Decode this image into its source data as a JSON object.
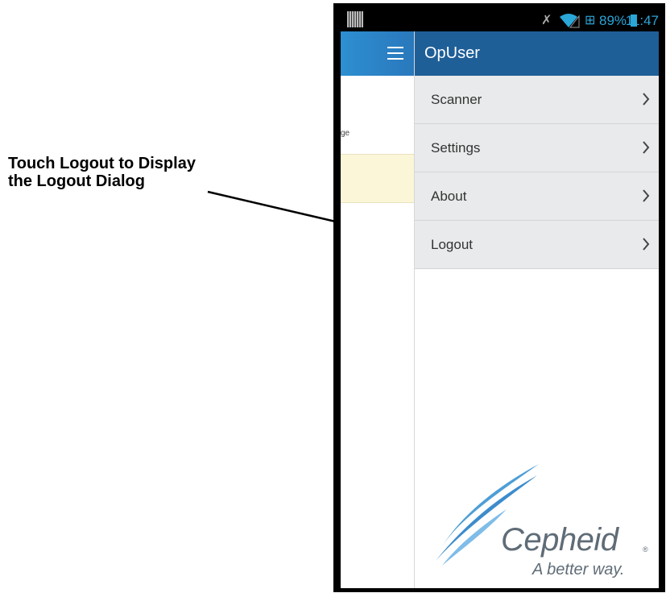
{
  "callout": {
    "line1": "Touch Logout to Display",
    "line2": "the Logout Dialog"
  },
  "status_bar": {
    "battery": "89%",
    "time": "11:47"
  },
  "background_screen": {
    "fragment_text": "ge"
  },
  "drawer": {
    "title": "OpUser",
    "items": [
      {
        "label": "Scanner"
      },
      {
        "label": "Settings"
      },
      {
        "label": "About"
      },
      {
        "label": "Logout"
      }
    ]
  },
  "logo": {
    "name": "Cepheid",
    "tagline": "A better way."
  },
  "colors": {
    "drawer_header": "#1f5f98",
    "app_bar": "#2d8fd1",
    "status_accent": "#2aa6d8",
    "menu_item_bg": "#e8eaeb"
  }
}
